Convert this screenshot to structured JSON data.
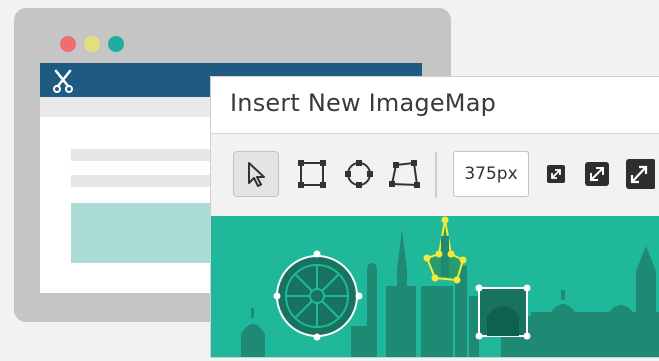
{
  "colors": {
    "background": "#f2f2f2",
    "browser_frame": "#c5c5c5",
    "dot_red": "#ee6e6e",
    "dot_yellow": "#e2e07e",
    "dot_green": "#1fae9b",
    "header_blue": "#1f5a82",
    "teal_block": "#acdcd6",
    "canvas_teal": "#1fb89a",
    "skyline_dark": "#1e8a73",
    "hotspot_yellow": "#f2ea3a"
  },
  "browser": {
    "dots": [
      "close-dot",
      "minimize-dot",
      "maximize-dot"
    ],
    "logo_icon": "scissors-icon"
  },
  "dialog": {
    "title": "Insert New ImageMap",
    "width_value": "375px",
    "tools": [
      {
        "name": "pointer-tool",
        "icon": "cursor-arrow-icon",
        "selected": true
      },
      {
        "name": "rectangle-tool",
        "icon": "rectangle-icon"
      },
      {
        "name": "circle-tool",
        "icon": "circle-icon"
      },
      {
        "name": "polygon-tool",
        "icon": "polygon-icon"
      }
    ],
    "actions": [
      {
        "name": "expand-small-button",
        "icon": "expand-small-icon"
      },
      {
        "name": "expand-medium-button",
        "icon": "expand-medium-icon"
      },
      {
        "name": "expand-large-button",
        "icon": "expand-large-icon"
      }
    ]
  }
}
